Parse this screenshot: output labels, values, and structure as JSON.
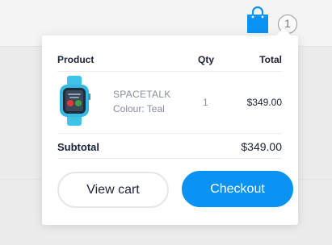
{
  "header": {
    "cart_icon": "shopping-bag-icon",
    "cart_count": "1",
    "accent_color": "#0a93f2"
  },
  "cart": {
    "columns": {
      "product": "Product",
      "qty": "Qty",
      "total": "Total"
    },
    "items": [
      {
        "image_icon": "smartwatch-image",
        "name": "SPACETALK",
        "colour": "Colour: Teal",
        "qty": "1",
        "price": "$349.00"
      }
    ],
    "subtotal_label": "Subtotal",
    "subtotal_value": "$349.00",
    "view_cart_label": "View cart",
    "checkout_label": "Checkout"
  }
}
